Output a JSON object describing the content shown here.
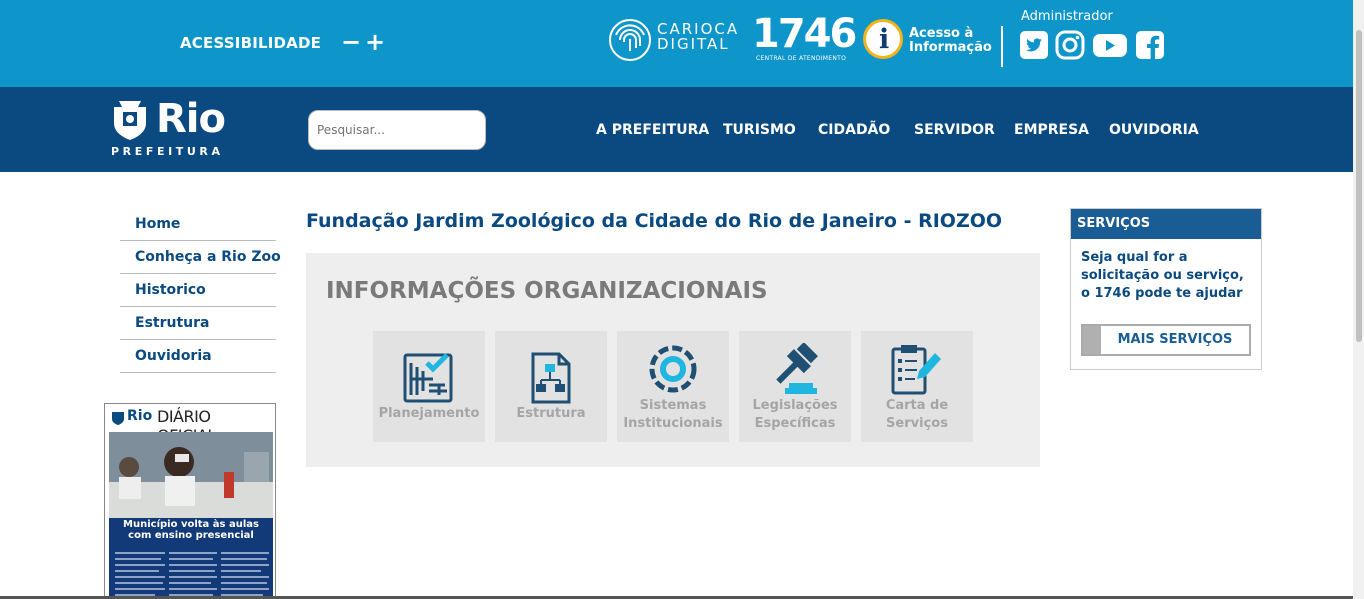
{
  "topbar": {
    "accessibility_label": "ACESSIBILIDADE",
    "decrease_label": "−",
    "increase_label": "+",
    "carioca_digital_line1": "CARIOCA",
    "carioca_digital_line2": "DIGITAL",
    "n1746": "1746",
    "n1746_sub": "CENTRAL DE ATENDIMENTO",
    "acesso_line1": "Acesso à",
    "acesso_line2": "Informação",
    "admin_label": "Administrador",
    "social_icons": [
      "twitter-icon",
      "instagram-icon",
      "youtube-icon",
      "facebook-icon"
    ]
  },
  "nav": {
    "logo_text": "Rio",
    "logo_sub": "PREFEITURA",
    "search_placeholder": "Pesquisar...",
    "menu": [
      "A PREFEITURA",
      "TURISMO",
      "CIDADÃO",
      "SERVIDOR",
      "EMPRESA",
      "OUVIDORIA"
    ]
  },
  "sidebar": {
    "items": [
      "Home",
      "Conheça a Rio Zoo",
      "Historico",
      "Estrutura",
      "Ouvidoria"
    ],
    "diario": {
      "rio": "Rio",
      "title": "DIÁRIO OFICIAL",
      "headline_line1": "Município volta às aulas",
      "headline_line2": "com ensino presencial"
    }
  },
  "main": {
    "title": "Fundação Jardim Zoológico da Cidade do Rio de Janeiro - RIOZOO",
    "section_title": "INFORMAÇÕES ORGANIZACIONAIS",
    "cards": [
      {
        "line1": "Planejamento",
        "line2": "",
        "icon": "planning-icon"
      },
      {
        "line1": "Estrutura",
        "line2": "",
        "icon": "structure-icon"
      },
      {
        "line1": "Sistemas",
        "line2": "Institucionais",
        "icon": "systems-icon"
      },
      {
        "line1": "Legislações",
        "line2": "Específicas",
        "icon": "gavel-icon"
      },
      {
        "line1": "Carta de",
        "line2": "Serviços",
        "icon": "checklist-icon"
      }
    ]
  },
  "services": {
    "header": "SERVIÇOS",
    "text": "Seja qual for a solicitação ou serviço, o 1746 pode te ajudar",
    "button": "MAIS SERVIÇOS"
  },
  "colors": {
    "topbar": "#0e96ca",
    "nav": "#0a4a80",
    "accent_blue": "#0a4a80",
    "icon_blue": "#1f4f72",
    "icon_cyan": "#1fb6e0",
    "panel_grey": "#eeeeee"
  }
}
